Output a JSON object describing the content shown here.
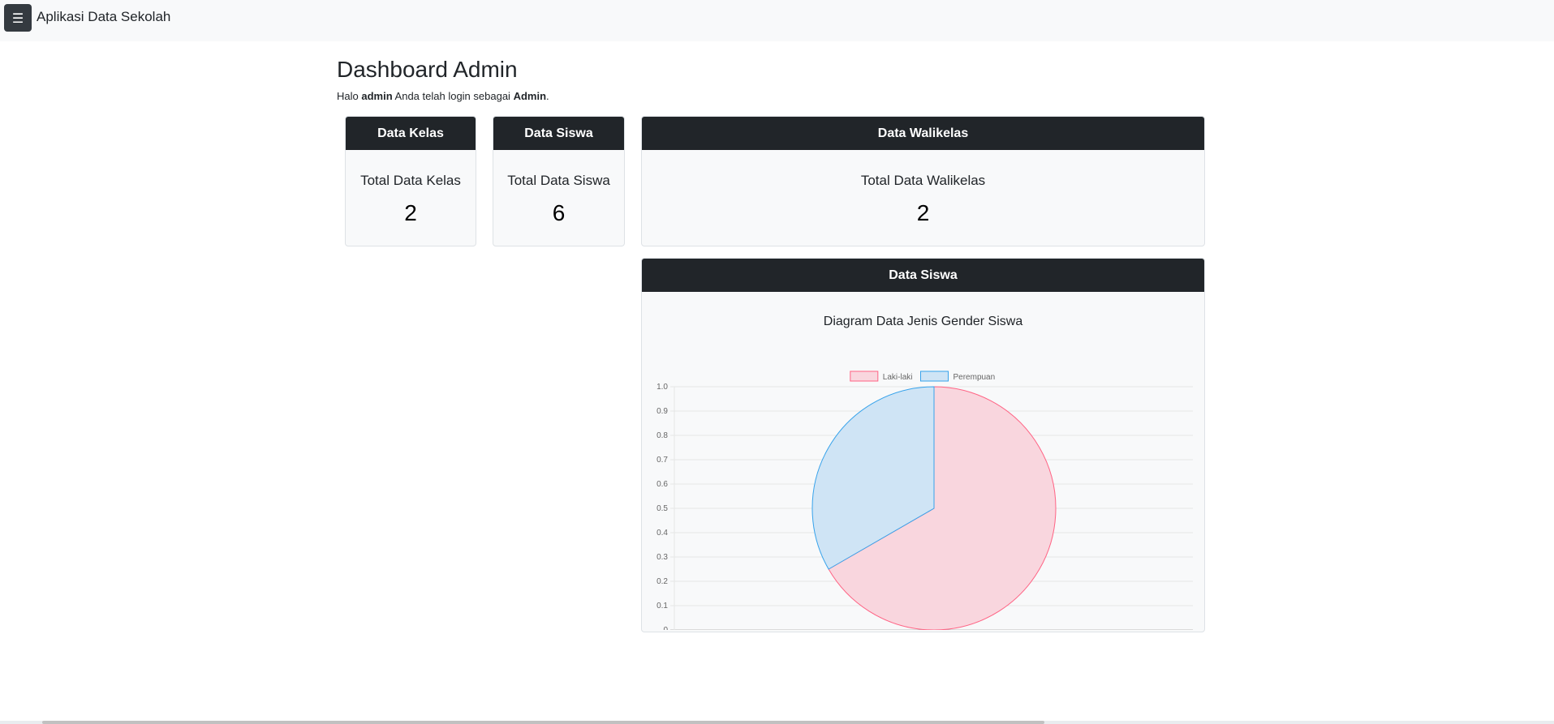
{
  "navbar": {
    "menu_icon": "☰",
    "brand": "Aplikasi Data Sekolah"
  },
  "page": {
    "title": "Dashboard Admin",
    "greeting_prefix": "Halo ",
    "username": "admin",
    "greeting_middle": " Anda telah login sebagai ",
    "role": "Admin",
    "greeting_suffix": "."
  },
  "cards": {
    "kelas": {
      "header": "Data Kelas",
      "label": "Total Data Kelas",
      "value": "2"
    },
    "siswa": {
      "header": "Data Siswa",
      "label": "Total Data Siswa",
      "value": "6"
    },
    "walikelas": {
      "header": "Data Walikelas",
      "label": "Total Data Walikelas",
      "value": "2"
    }
  },
  "chart_card": {
    "header": "Data Siswa",
    "subtitle": "Diagram Data Jenis Gender Siswa"
  },
  "chart_data": {
    "type": "pie",
    "title": "Diagram Data Jenis Gender Siswa",
    "categories": [
      "Laki-laki",
      "Perempuan"
    ],
    "values": [
      4,
      2
    ],
    "colors": {
      "Laki-laki": {
        "fill": "#f9d6de",
        "stroke": "#ff6384"
      },
      "Perempuan": {
        "fill": "#cfe4f5",
        "stroke": "#36a2eb"
      }
    },
    "legend_position": "top",
    "ylim": [
      0,
      1.0
    ],
    "yticks": [
      "1.0",
      "0.9",
      "0.8",
      "0.7",
      "0.6",
      "0.5",
      "0.4",
      "0.3",
      "0.2",
      "0.1",
      "0"
    ],
    "grid": true
  }
}
